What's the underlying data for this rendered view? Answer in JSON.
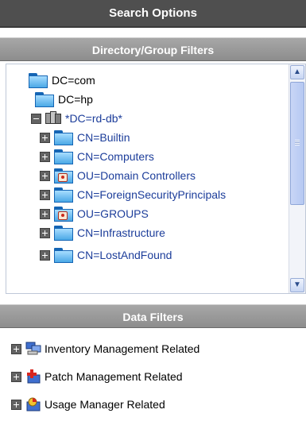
{
  "search_options": {
    "title": "Search Options"
  },
  "directory_filters": {
    "title": "Directory/Group Filters",
    "nodes": [
      {
        "label": "DC=com",
        "icon": "folder-icon",
        "expander": "none",
        "blue": false
      },
      {
        "label": "DC=hp",
        "icon": "folder-icon",
        "expander": "none",
        "blue": false
      },
      {
        "label": "*DC=rd-db*",
        "icon": "domain-icon",
        "expander": "minus",
        "blue": true
      },
      {
        "label": "CN=Builtin",
        "icon": "folder-icon",
        "expander": "plus",
        "blue": true
      },
      {
        "label": "CN=Computers",
        "icon": "folder-icon",
        "expander": "plus",
        "blue": true
      },
      {
        "label": "OU=Domain Controllers",
        "icon": "ou-folder-icon",
        "expander": "plus",
        "blue": true
      },
      {
        "label": "CN=ForeignSecurityPrincipals",
        "icon": "folder-icon",
        "expander": "plus",
        "blue": true
      },
      {
        "label": "OU=GROUPS",
        "icon": "ou-folder-icon",
        "expander": "plus",
        "blue": true
      },
      {
        "label": "CN=Infrastructure",
        "icon": "folder-icon",
        "expander": "plus",
        "blue": true
      },
      {
        "label": "CN=LostAndFound",
        "icon": "folder-icon",
        "expander": "plus",
        "blue": true
      }
    ]
  },
  "data_filters": {
    "title": "Data Filters",
    "items": [
      {
        "label": "Inventory Management Related",
        "icon": "inventory-icon"
      },
      {
        "label": "Patch Management Related",
        "icon": "patch-icon"
      },
      {
        "label": "Usage Manager Related",
        "icon": "usage-icon"
      }
    ]
  },
  "colors": {
    "header_bg": "#4f4f4f",
    "section_bg": "#9a9a9a",
    "link_blue": "#1c3d9a",
    "folder_blue": "#4aa8e6"
  }
}
